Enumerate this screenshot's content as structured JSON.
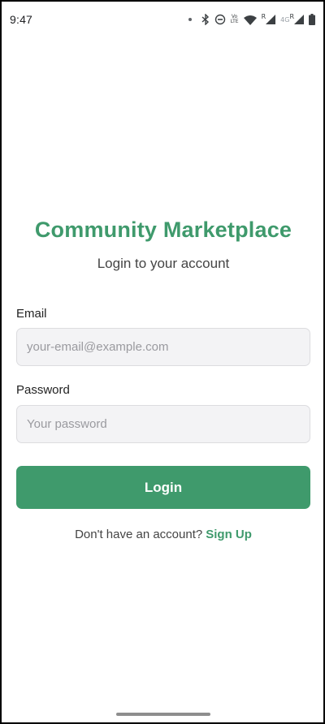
{
  "status_bar": {
    "time": "9:47",
    "volte_top": "Vo",
    "volte_mid": "LTE",
    "net_r1": "R",
    "net_4g": "4G",
    "net_r2": "R",
    "icons": [
      "notification-dot-icon",
      "bluetooth-icon",
      "do-not-disturb-icon",
      "volte-icon",
      "wifi-icon",
      "signal-icon",
      "battery-icon"
    ]
  },
  "header": {
    "title": "Community Marketplace",
    "subtitle": "Login to your account"
  },
  "form": {
    "email_label": "Email",
    "email_placeholder": "your-email@example.com",
    "email_value": "",
    "password_label": "Password",
    "password_placeholder": "Your password",
    "password_value": "",
    "login_label": "Login"
  },
  "footer": {
    "prompt": "Don't have an account?",
    "signup_label": "Sign Up"
  },
  "colors": {
    "accent": "#3f9a6c",
    "input_bg": "#f3f3f5"
  }
}
